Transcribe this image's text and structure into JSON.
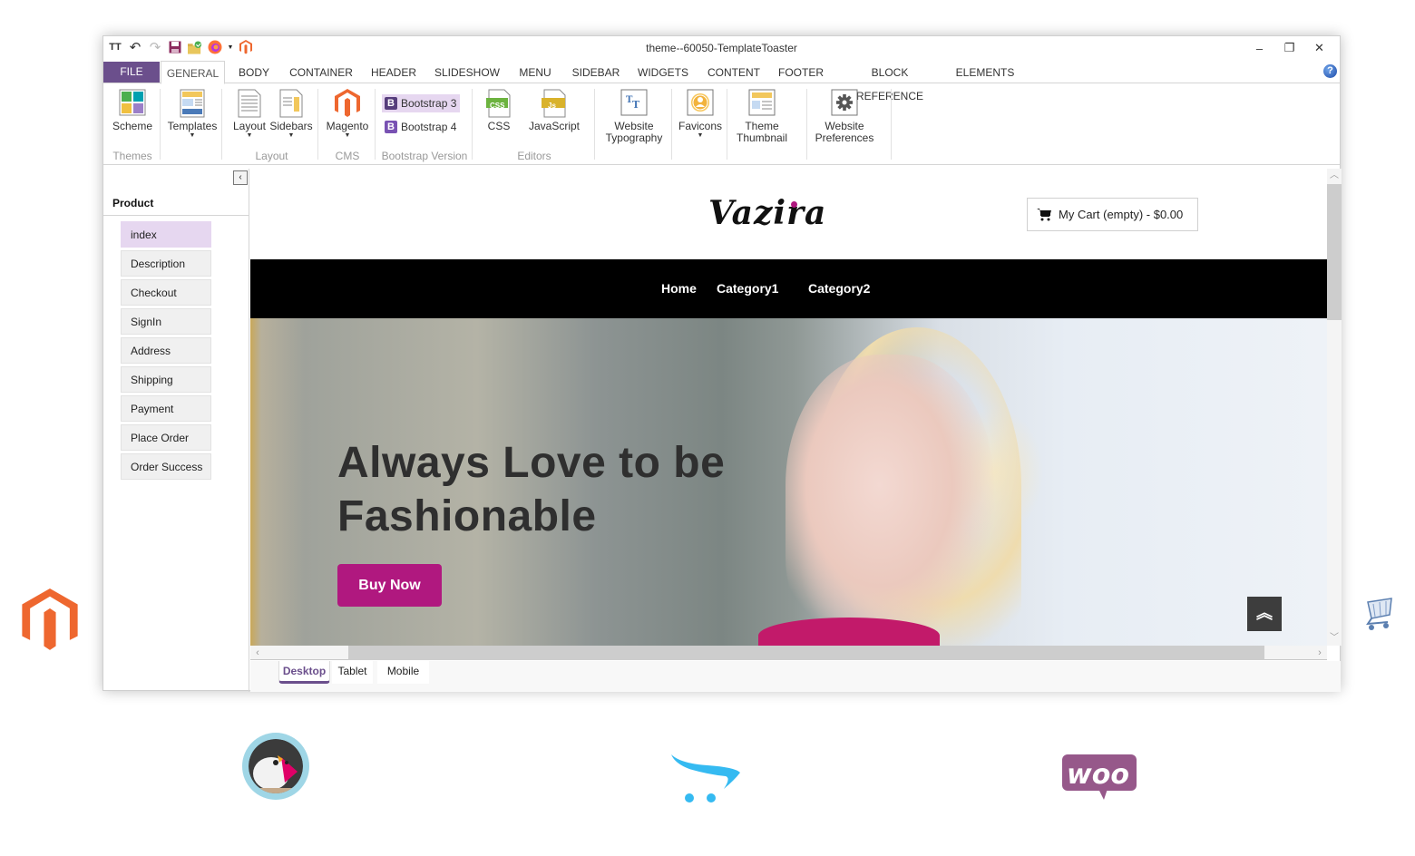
{
  "window": {
    "title": "theme--60050-TemplateToaster",
    "quick_access": [
      "typography-icon",
      "undo-icon",
      "redo-icon",
      "save-icon",
      "open-folder-icon",
      "firefox-preview-icon",
      "magento-icon"
    ],
    "controls": {
      "minimize": "–",
      "restore": "❐",
      "close": "✕"
    }
  },
  "ribbon_tabs": {
    "file": "FILE",
    "items": [
      "GENERAL",
      "BODY",
      "CONTAINER",
      "HEADER",
      "SLIDESHOW",
      "MENU",
      "SIDEBAR",
      "WIDGETS",
      "CONTENT",
      "FOOTER",
      "BLOCK REFERENCE",
      "ELEMENTS"
    ],
    "active": "GENERAL",
    "help": "?"
  },
  "ribbon": {
    "scheme": "Scheme",
    "templates": "Templates",
    "layout": "Layout",
    "sidebars": "Sidebars",
    "magento": "Magento",
    "bootstrap3": "Bootstrap 3",
    "bootstrap4": "Bootstrap 4",
    "bootstrap_letter": "B",
    "css": "CSS",
    "css_badge": "CSS",
    "javascript": "JavaScript",
    "js_badge": "Js",
    "website_typography_1": "Website",
    "website_typography_2": "Typography",
    "favicons": "Favicons",
    "theme_thumbnail_1": "Theme",
    "theme_thumbnail_2": "Thumbnail",
    "website_preferences_1": "Website",
    "website_preferences_2": "Preferences",
    "groups": {
      "themes": "Themes",
      "layout": "Layout",
      "cms": "CMS",
      "bootstrap_version": "Bootstrap Version",
      "editors": "Editors"
    },
    "selected_bootstrap": "Bootstrap 3"
  },
  "left_panel": {
    "collapse": "‹",
    "title": "Product",
    "pages": [
      "index",
      "Description",
      "Checkout",
      "SignIn",
      "Address",
      "Shipping",
      "Payment",
      "Place Order",
      "Order Success"
    ],
    "active_page": "index"
  },
  "site": {
    "logo": "Vazira",
    "cart": "My Cart (empty) - $0.00",
    "nav": [
      "Home",
      "Category1",
      "Category2"
    ],
    "hero_title_line1": "Always Love to be",
    "hero_title_line2": "Fashionable",
    "buy_button": "Buy Now",
    "back_to_top": "︽"
  },
  "colors": {
    "accent_purple": "#6b4f8c",
    "brand_magenta": "#b0187f",
    "selection": "#e6d7f0",
    "nav_bg": "#000000"
  },
  "view_tabs": {
    "items": [
      "Desktop",
      "Tablet",
      "Mobile"
    ],
    "active": "Desktop"
  },
  "platform_logos": [
    "magento-logo",
    "prestashop-logo",
    "opencart-logo",
    "woocommerce-logo",
    "shopping-cart-logo"
  ]
}
